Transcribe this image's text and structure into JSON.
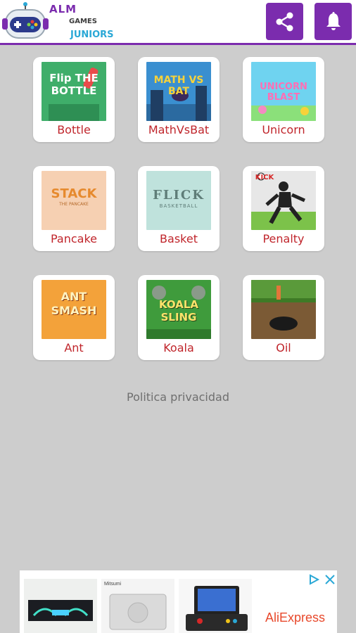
{
  "header": {
    "logo": {
      "line1": "ALM",
      "line2": "GAMES",
      "line3": "JUNIORS"
    },
    "share_icon": "share-icon",
    "bell_icon": "bell-icon",
    "accent": "#7b2cae"
  },
  "games": [
    {
      "label": "Bottle",
      "thumb_text": "Flip THE BOTTLE"
    },
    {
      "label": "MathVsBat",
      "thumb_text": "MATH VS BAT"
    },
    {
      "label": "Unicorn",
      "thumb_text": "UNICORN BLAST"
    },
    {
      "label": "Pancake",
      "thumb_text": "STACK",
      "thumb_sub": "THE PANCAKE"
    },
    {
      "label": "Basket",
      "thumb_text": "FLICK",
      "thumb_sub": "BASKETBALL"
    },
    {
      "label": "Penalty",
      "thumb_text": "KICK"
    },
    {
      "label": "Ant",
      "thumb_text": "ANT SMASH"
    },
    {
      "label": "Koala",
      "thumb_text": "KOALA SLING"
    },
    {
      "label": "Oil",
      "thumb_text": ""
    }
  ],
  "footer": {
    "privacy": "Politica privacidad"
  },
  "ad": {
    "brand": "AliExpress",
    "tile2_brand": "Mitsumi"
  },
  "colors": {
    "label_red": "#c0252b",
    "background": "#cdcdcd"
  }
}
